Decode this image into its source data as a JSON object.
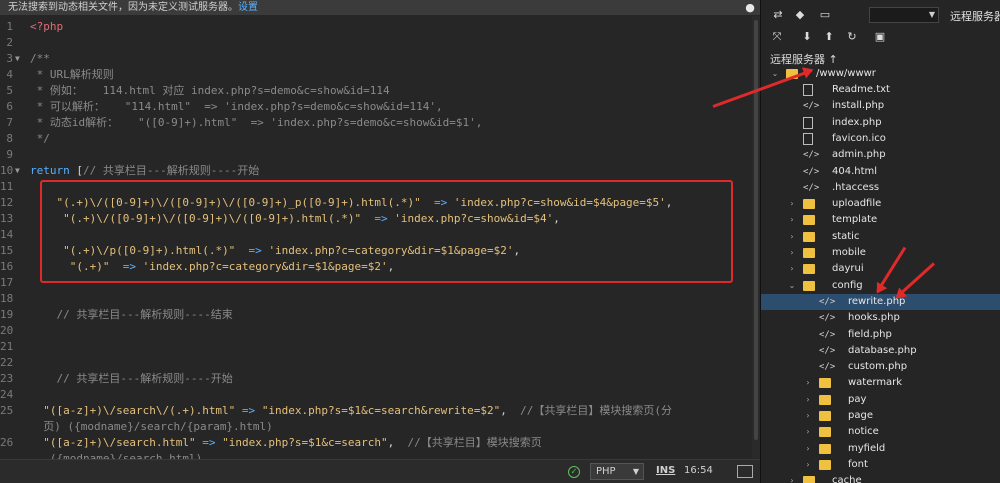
{
  "notice": {
    "text": "无法搜索到动态相关文件，因为未定义测试服务器。",
    "link": "设置"
  },
  "code": {
    "lines": [
      {
        "n": "1",
        "fold": "",
        "indent": "",
        "segments": [
          [
            "php-tag",
            "<?php"
          ]
        ]
      },
      {
        "n": "2",
        "fold": "",
        "indent": "",
        "segments": []
      },
      {
        "n": "3",
        "fold": "▼",
        "indent": "",
        "segments": [
          [
            "comment",
            "/**"
          ]
        ]
      },
      {
        "n": "4",
        "fold": "",
        "indent": "",
        "segments": [
          [
            "comment",
            " * URL解析规则"
          ]
        ]
      },
      {
        "n": "5",
        "fold": "",
        "indent": "",
        "segments": [
          [
            "comment",
            " * 例如：   114.html 对应 index.php?s=demo&c=show&id=114"
          ]
        ]
      },
      {
        "n": "6",
        "fold": "",
        "indent": "",
        "segments": [
          [
            "comment",
            " * 可以解析：   \"114.html\"  => 'index.php?s=demo&c=show&id=114',"
          ]
        ]
      },
      {
        "n": "7",
        "fold": "",
        "indent": "",
        "segments": [
          [
            "comment",
            " * 动态id解析：   \"([0-9]+).html\"  => 'index.php?s=demo&c=show&id=$1',"
          ]
        ]
      },
      {
        "n": "8",
        "fold": "",
        "indent": "",
        "segments": [
          [
            "comment",
            " */"
          ]
        ]
      },
      {
        "n": "9",
        "fold": "",
        "indent": "",
        "segments": []
      },
      {
        "n": "10",
        "fold": "▼",
        "indent": "",
        "segments": [
          [
            "kw",
            "return"
          ],
          [
            "punct",
            " ["
          ],
          [
            "comment",
            "// 共享栏目---解析规则----开始"
          ]
        ]
      },
      {
        "n": "11",
        "fold": "",
        "indent": "",
        "segments": []
      },
      {
        "n": "12",
        "fold": "",
        "indent": "    ",
        "segments": [
          [
            "str2",
            "\"(.+)\\/([0-9]+)\\/([0-9]+)\\/([0-9]+)_p([0-9]+).html(.*)\""
          ],
          [
            "kw",
            "  => "
          ],
          [
            "str2",
            "'index.php?c=show&id=$4&page=$5'"
          ],
          [
            "punct",
            ","
          ]
        ]
      },
      {
        "n": "13",
        "fold": "",
        "indent": "    ",
        "segments": [
          [
            "str2",
            " \"(.+)\\/([0-9]+)\\/([0-9]+)\\/([0-9]+).html(.*)\""
          ],
          [
            "kw",
            "  => "
          ],
          [
            "str2",
            "'index.php?c=show&id=$4'"
          ],
          [
            "punct",
            ","
          ]
        ]
      },
      {
        "n": "14",
        "fold": "",
        "indent": "",
        "segments": []
      },
      {
        "n": "15",
        "fold": "",
        "indent": "    ",
        "segments": [
          [
            "str2",
            " \"(.+)\\/p([0-9]+).html(.*)\""
          ],
          [
            "kw",
            "  => "
          ],
          [
            "str2",
            "'index.php?c=category&dir=$1&page=$2'"
          ],
          [
            "punct",
            ","
          ]
        ]
      },
      {
        "n": "16",
        "fold": "",
        "indent": "    ",
        "segments": [
          [
            "str2",
            "  \"(.+)\""
          ],
          [
            "kw",
            "  => "
          ],
          [
            "str2",
            "'index.php?c=category&dir=$1&page=$2'"
          ],
          [
            "punct",
            ","
          ]
        ]
      },
      {
        "n": "17",
        "fold": "",
        "indent": "",
        "segments": []
      },
      {
        "n": "18",
        "fold": "",
        "indent": "",
        "segments": []
      },
      {
        "n": "19",
        "fold": "",
        "indent": "    ",
        "segments": [
          [
            "comment",
            "// 共享栏目---解析规则----结束"
          ]
        ]
      },
      {
        "n": "20",
        "fold": "",
        "indent": "",
        "segments": []
      },
      {
        "n": "21",
        "fold": "",
        "indent": "",
        "segments": []
      },
      {
        "n": "22",
        "fold": "",
        "indent": "",
        "segments": []
      },
      {
        "n": "23",
        "fold": "",
        "indent": "    ",
        "segments": [
          [
            "comment",
            "// 共享栏目---解析规则----开始"
          ]
        ]
      },
      {
        "n": "24",
        "fold": "",
        "indent": "",
        "segments": []
      },
      {
        "n": "25",
        "fold": "",
        "indent": "  ",
        "segments": [
          [
            "str2",
            "\"([a-z]+)\\/search\\/(.+).html\""
          ],
          [
            "kw",
            " => "
          ],
          [
            "str2",
            "\"index.php?s=$1&c=search&rewrite=$2\""
          ],
          [
            "punct",
            ",  "
          ],
          [
            "comment",
            "//【共享栏目】模块搜索页(分"
          ]
        ]
      },
      {
        "n": "",
        "fold": "",
        "indent": "  ",
        "segments": [
          [
            "comment",
            "页) ({modname}/search/{param}.html)"
          ]
        ]
      },
      {
        "n": "26",
        "fold": "",
        "indent": "  ",
        "segments": [
          [
            "str2",
            "\"([a-z]+)\\/search.html\""
          ],
          [
            "kw",
            " => "
          ],
          [
            "str2",
            "\"index.php?s=$1&c=search\""
          ],
          [
            "punct",
            ",  "
          ],
          [
            "comment",
            "//【共享栏目】模块搜索页"
          ]
        ]
      },
      {
        "n": "",
        "fold": "",
        "indent": "   ",
        "segments": [
          [
            "comment",
            "({modname}/search.html)"
          ]
        ]
      }
    ]
  },
  "status": {
    "language": "PHP",
    "mode": "INS",
    "time": "16:54"
  },
  "panel": {
    "remote_view": "远程服务器",
    "servers_title": "远程服务器 ↑",
    "root": "/www/wwwr",
    "tree": [
      {
        "depth": 1,
        "type": "file",
        "name": "Readme.txt"
      },
      {
        "depth": 1,
        "type": "code",
        "name": "install.php"
      },
      {
        "depth": 1,
        "type": "file",
        "name": "index.php"
      },
      {
        "depth": 1,
        "type": "file",
        "name": "favicon.ico"
      },
      {
        "depth": 1,
        "type": "code",
        "name": "admin.php"
      },
      {
        "depth": 1,
        "type": "code",
        "name": "404.html"
      },
      {
        "depth": 1,
        "type": "code",
        "name": ".htaccess"
      },
      {
        "depth": 1,
        "type": "folder",
        "name": "uploadfile",
        "chev": "›"
      },
      {
        "depth": 1,
        "type": "folder",
        "name": "template",
        "chev": "›"
      },
      {
        "depth": 1,
        "type": "folder",
        "name": "static",
        "chev": "›"
      },
      {
        "depth": 1,
        "type": "folder",
        "name": "mobile",
        "chev": "›"
      },
      {
        "depth": 1,
        "type": "folder",
        "name": "dayrui",
        "chev": "›"
      },
      {
        "depth": 1,
        "type": "folder",
        "name": "config",
        "chev": "⌄"
      },
      {
        "depth": 2,
        "type": "code",
        "name": "rewrite.php",
        "selected": true
      },
      {
        "depth": 2,
        "type": "code",
        "name": "hooks.php"
      },
      {
        "depth": 2,
        "type": "code",
        "name": "field.php"
      },
      {
        "depth": 2,
        "type": "code",
        "name": "database.php"
      },
      {
        "depth": 2,
        "type": "code",
        "name": "custom.php"
      },
      {
        "depth": 2,
        "type": "folder",
        "name": "watermark",
        "chev": "›"
      },
      {
        "depth": 2,
        "type": "folder",
        "name": "pay",
        "chev": "›"
      },
      {
        "depth": 2,
        "type": "folder",
        "name": "page",
        "chev": "›"
      },
      {
        "depth": 2,
        "type": "folder",
        "name": "notice",
        "chev": "›"
      },
      {
        "depth": 2,
        "type": "folder",
        "name": "myfield",
        "chev": "›"
      },
      {
        "depth": 2,
        "type": "folder",
        "name": "font",
        "chev": "›"
      },
      {
        "depth": 1,
        "type": "folder",
        "name": "cache",
        "chev": "›"
      }
    ]
  },
  "colors": {
    "highlight": "#e02a2a",
    "selection": "#2d4d6e",
    "folder": "#f0c040"
  }
}
